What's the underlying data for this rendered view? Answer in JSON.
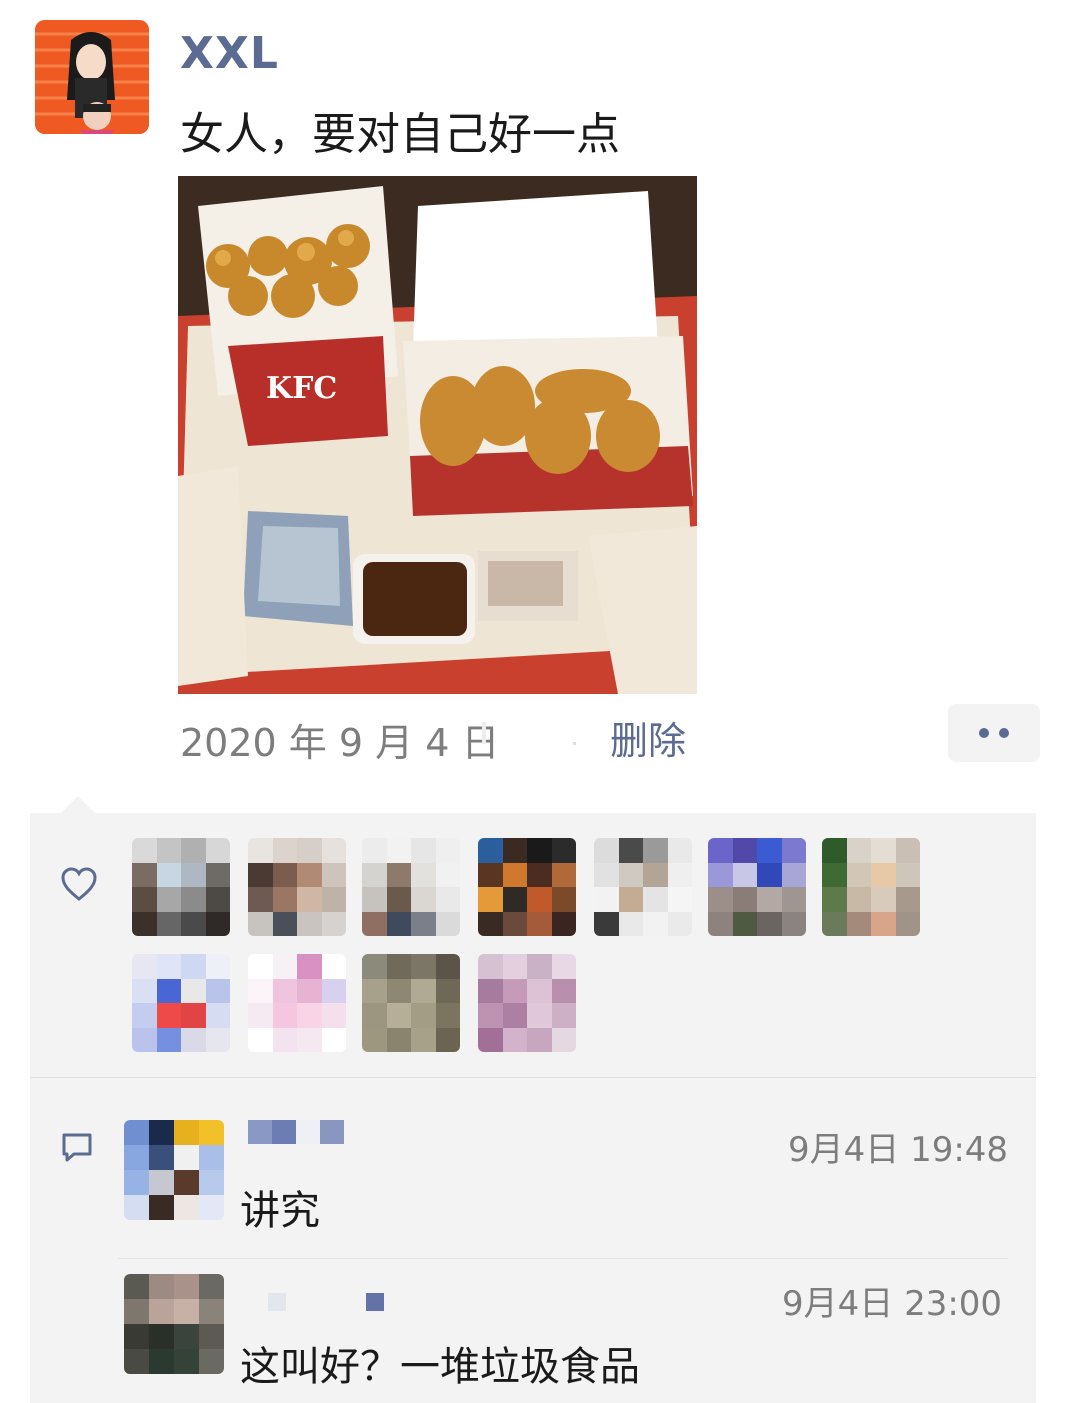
{
  "post": {
    "author": "XXL",
    "text": "女人，要对自己好一点",
    "photo_icon": "kfc-meal-photo",
    "date": "2020 年 9 月 4 日",
    "delete_label": "删除",
    "more_icon": "more-dots-icon"
  },
  "likes": {
    "icon": "heart-outline-icon",
    "count": 11
  },
  "comments": [
    {
      "time": "9月4日 19:48",
      "text": "讲究"
    },
    {
      "time": "9月4日 23:00",
      "text": "这叫好？一堆垃圾食品"
    }
  ],
  "colors": {
    "link": "#5b6b92",
    "panel_bg": "#f3f3f3",
    "meta_text": "#7d7d7d",
    "avatar_bg": "#ef5a23"
  }
}
